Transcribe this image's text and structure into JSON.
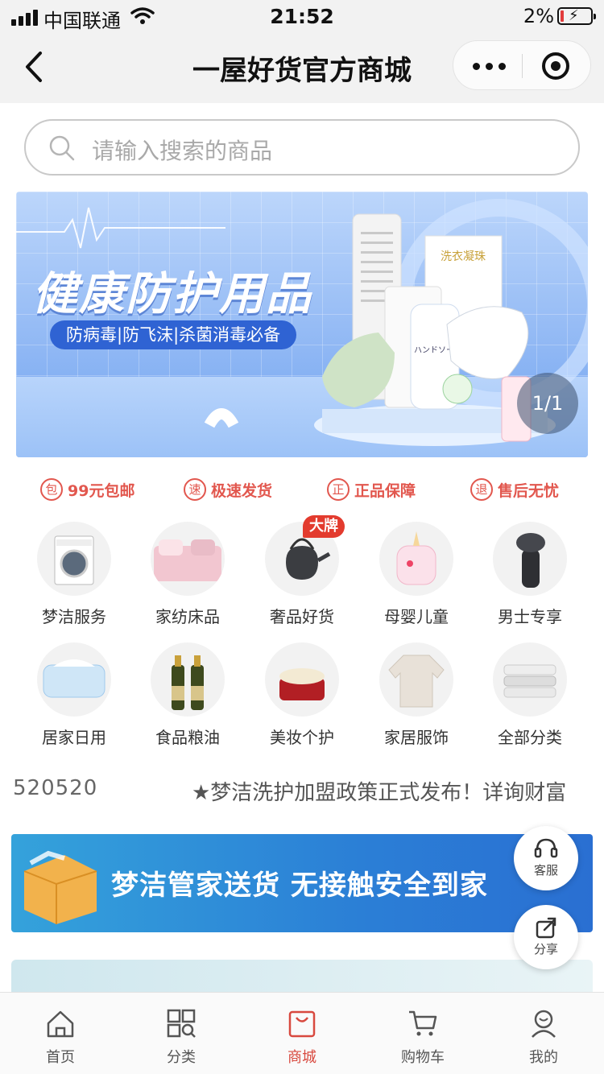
{
  "status_bar": {
    "carrier": "中国联通",
    "time": "21:52",
    "battery": "2%"
  },
  "nav": {
    "title": "一屋好货官方商城"
  },
  "search": {
    "placeholder": "请输入搜索的商品"
  },
  "banner": {
    "headline": "健康防护用品",
    "subtitle": "防病毒|防飞沫|杀菌消毒必备",
    "pager": "1/1",
    "product_text": {
      "detergent": "洗衣凝珠",
      "soap": "ハンドソープ"
    }
  },
  "guarantees": [
    {
      "icon": "包",
      "label": "99元包邮"
    },
    {
      "icon": "速",
      "label": "极速发货"
    },
    {
      "icon": "正",
      "label": "正品保障"
    },
    {
      "icon": "退",
      "label": "售后无忧"
    }
  ],
  "categories": [
    {
      "label": "梦洁服务"
    },
    {
      "label": "家纺床品"
    },
    {
      "label": "奢品好货",
      "badge": "大牌"
    },
    {
      "label": "母婴儿童"
    },
    {
      "label": "男士专享"
    },
    {
      "label": "居家日用"
    },
    {
      "label": "食品粮油"
    },
    {
      "label": "美妆个护"
    },
    {
      "label": "家居服饰"
    },
    {
      "label": "全部分类"
    }
  ],
  "ticker": {
    "number": "520520",
    "message": "★梦洁洗护加盟政策正式发布！详询财富"
  },
  "promo": {
    "text": "梦洁管家送货 无接触安全到家"
  },
  "floating": {
    "service": "客服",
    "share": "分享"
  },
  "tabbar": [
    {
      "label": "首页",
      "icon": "home-icon"
    },
    {
      "label": "分类",
      "icon": "grid-icon"
    },
    {
      "label": "商城",
      "icon": "shopping-bag-icon",
      "active": true
    },
    {
      "label": "购物车",
      "icon": "cart-icon"
    },
    {
      "label": "我的",
      "icon": "user-icon"
    }
  ],
  "colors": {
    "accent": "#d8493f",
    "banner_blue": "#6ea2ef",
    "promo_blue": "#2b7fd6"
  }
}
